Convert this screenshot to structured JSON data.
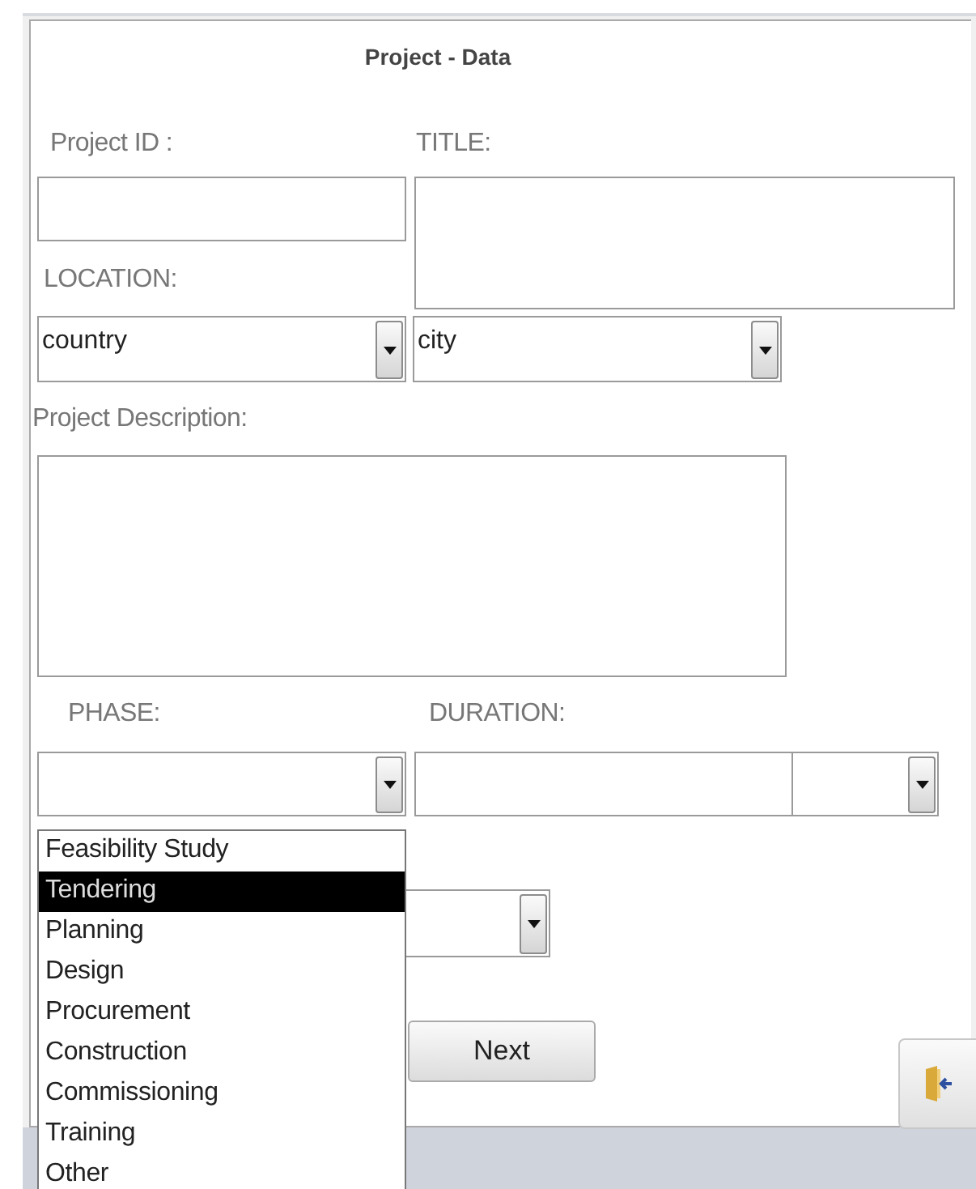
{
  "window": {
    "title": "Project - Data"
  },
  "project_id": {
    "label": "Project ID :"
  },
  "title_field": {
    "label": "TITLE:"
  },
  "location": {
    "label": "LOCATION:",
    "country": {
      "value": "country"
    },
    "city": {
      "value": "city"
    }
  },
  "description": {
    "label": "Project Description:"
  },
  "phase": {
    "label": "PHASE:",
    "expanded": true,
    "options": [
      {
        "label": "Feasibility Study",
        "selected": false
      },
      {
        "label": "Tendering",
        "selected": true
      },
      {
        "label": "Planning",
        "selected": false
      },
      {
        "label": "Design",
        "selected": false
      },
      {
        "label": "Procurement",
        "selected": false
      },
      {
        "label": "Construction",
        "selected": false
      },
      {
        "label": "Commissioning",
        "selected": false
      },
      {
        "label": "Training",
        "selected": false
      },
      {
        "label": "Other",
        "selected": false
      }
    ]
  },
  "duration": {
    "label": "DURATION:"
  },
  "buttons": {
    "next": "Next"
  }
}
